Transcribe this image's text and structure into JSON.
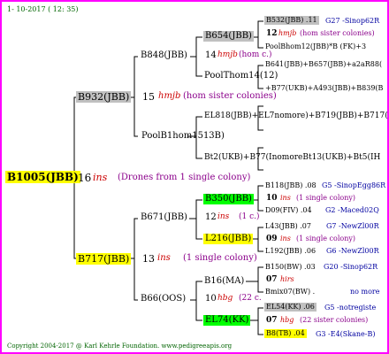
{
  "header_date": "1- 10-2017 ( 12: 35)",
  "footer": "Copyright 2004-2017 @ Karl Kehrle Foundation.   www.pedigreeapis.org",
  "colors": {
    "frame": "#ff00ff",
    "gray_box": "#c0c0c0",
    "yellow_box": "#ffff00",
    "green_box": "#00ff00",
    "red_text": "#cc0000",
    "blue_text": "#0000a0"
  },
  "root": {
    "name": "B1005(JBB)",
    "gen": "16",
    "breed": "ins",
    "note": "(Drones from 1 single colony)"
  },
  "parents": {
    "upper": {
      "name": "B932(JBB)",
      "gen": "15",
      "breed": "hmjb",
      "note": "(hom sister colonies)",
      "pool": "PoolB1hom1513B)"
    },
    "lower": {
      "name": "B717(JBB)",
      "gen": "13",
      "breed": "ins",
      "note": "(1 single colony)"
    }
  },
  "grandparents": {
    "b848": {
      "name": "B848(JBB)",
      "gen": "14",
      "breed": "hmjb",
      "note": "(hom c.)"
    },
    "b671": {
      "name": "B671(JBB)",
      "gen": "12",
      "breed": "ins",
      "note": "(1 c.)"
    },
    "b66": {
      "name": "B66(OOS)",
      "gen": "10",
      "breed": "hbg",
      "note": "(22 c."
    }
  },
  "third_gen": {
    "b654": "B654(JBB)",
    "poolthom": "PoolThom14(12)",
    "el818": "EL818(JBB)+EL7nomore)+B719(JBB)+B717(J",
    "bt2": "Bt2(UKB)+B77(InomoreBt13(UKB)+Bt5(IH",
    "b350": "B350(JBB)",
    "l216": "L216(JBB)",
    "b16": "B16(MA)",
    "el74": "EL74(KK)"
  },
  "fourth_gen": {
    "r1_name": "B532(JBB) .11",
    "r1_info": "G27 -Sinop62R",
    "r2_gen": "12",
    "r2_breed": "hmjb",
    "r2_note": "(hom sister colonies)",
    "r3": "PoolBhom12(JBB)*B (FK)+3",
    "r4": "B641(JBB)+B657(JBB)+a2aR88(",
    "r5": "+B77(UKB)+A493(JBB)+B839(B",
    "r6": "B118(JBB) .08",
    "r6_info": "G5 -SinopEgg86R",
    "r7_gen": "10",
    "r7_breed": "ins",
    "r7_note": "(1 single colony)",
    "r8": "D09(FIV) .04",
    "r8_info": "G2 -Maced02Q",
    "r9": "L43(JBB) .07",
    "r9_info": "G7 -NewZl00R",
    "r10_gen": "09",
    "r10_breed": "ins",
    "r10_note": "(1 single colony)",
    "r11": "L192(JBB) .06",
    "r11_info": "G6 -NewZl00R",
    "r12": "B150(BW) .03",
    "r12_info": "G20 -Sinop62R",
    "r13_gen": "07",
    "r13_breed": "hirs",
    "r14": "Bmix07(BW) .",
    "r14_info": "no more",
    "r15": "EL54(KK) .06",
    "r15_info": "G5 -notregiste",
    "r16_gen": "07",
    "r16_breed": "hbg",
    "r16_note": "(22 sister colonies)",
    "r17": "B8(TB) .04",
    "r17_info": "G3 -E4(Skane-B)"
  }
}
